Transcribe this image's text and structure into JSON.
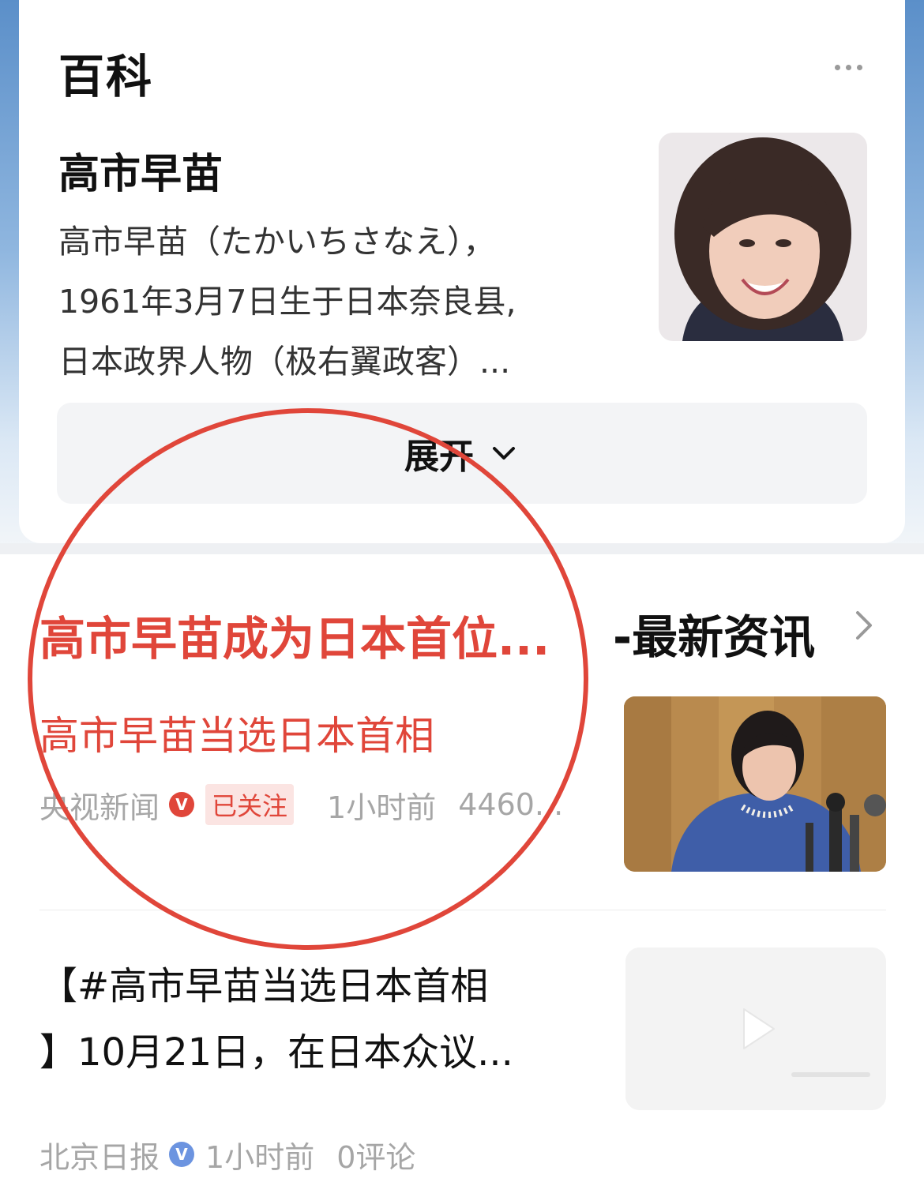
{
  "baike": {
    "section_title": "百科",
    "entity_name": "高市早苗",
    "description_lines": [
      "高市早苗（たかいちさなえ），",
      "1961年3月7日生于日本奈良县,",
      "日本政界人物（极右翼政客）..."
    ],
    "expand_label": "展开",
    "portrait_icon": "person-photo"
  },
  "news": {
    "headline_left": "高市早苗成为日本首位...",
    "headline_right": "-最新资讯",
    "items": [
      {
        "title": "高市早苗当选日本首相",
        "source": "央视新闻",
        "badge": "V",
        "follow_tag": "已关注",
        "time": "1小时前",
        "count": "4460...",
        "thumb_icon": "news-photo"
      },
      {
        "text_lines": [
          "【#高市早苗当选日本首相",
          "】10月21日，在日本众议..."
        ],
        "source": "北京日报",
        "badge": "V",
        "time": "1小时前",
        "comments": "0评论",
        "thumb_icon": "play-icon"
      }
    ]
  },
  "colors": {
    "accent_red": "#e0463a",
    "verified_blue": "#6c94e0",
    "gray_text": "#a6a6a6"
  }
}
